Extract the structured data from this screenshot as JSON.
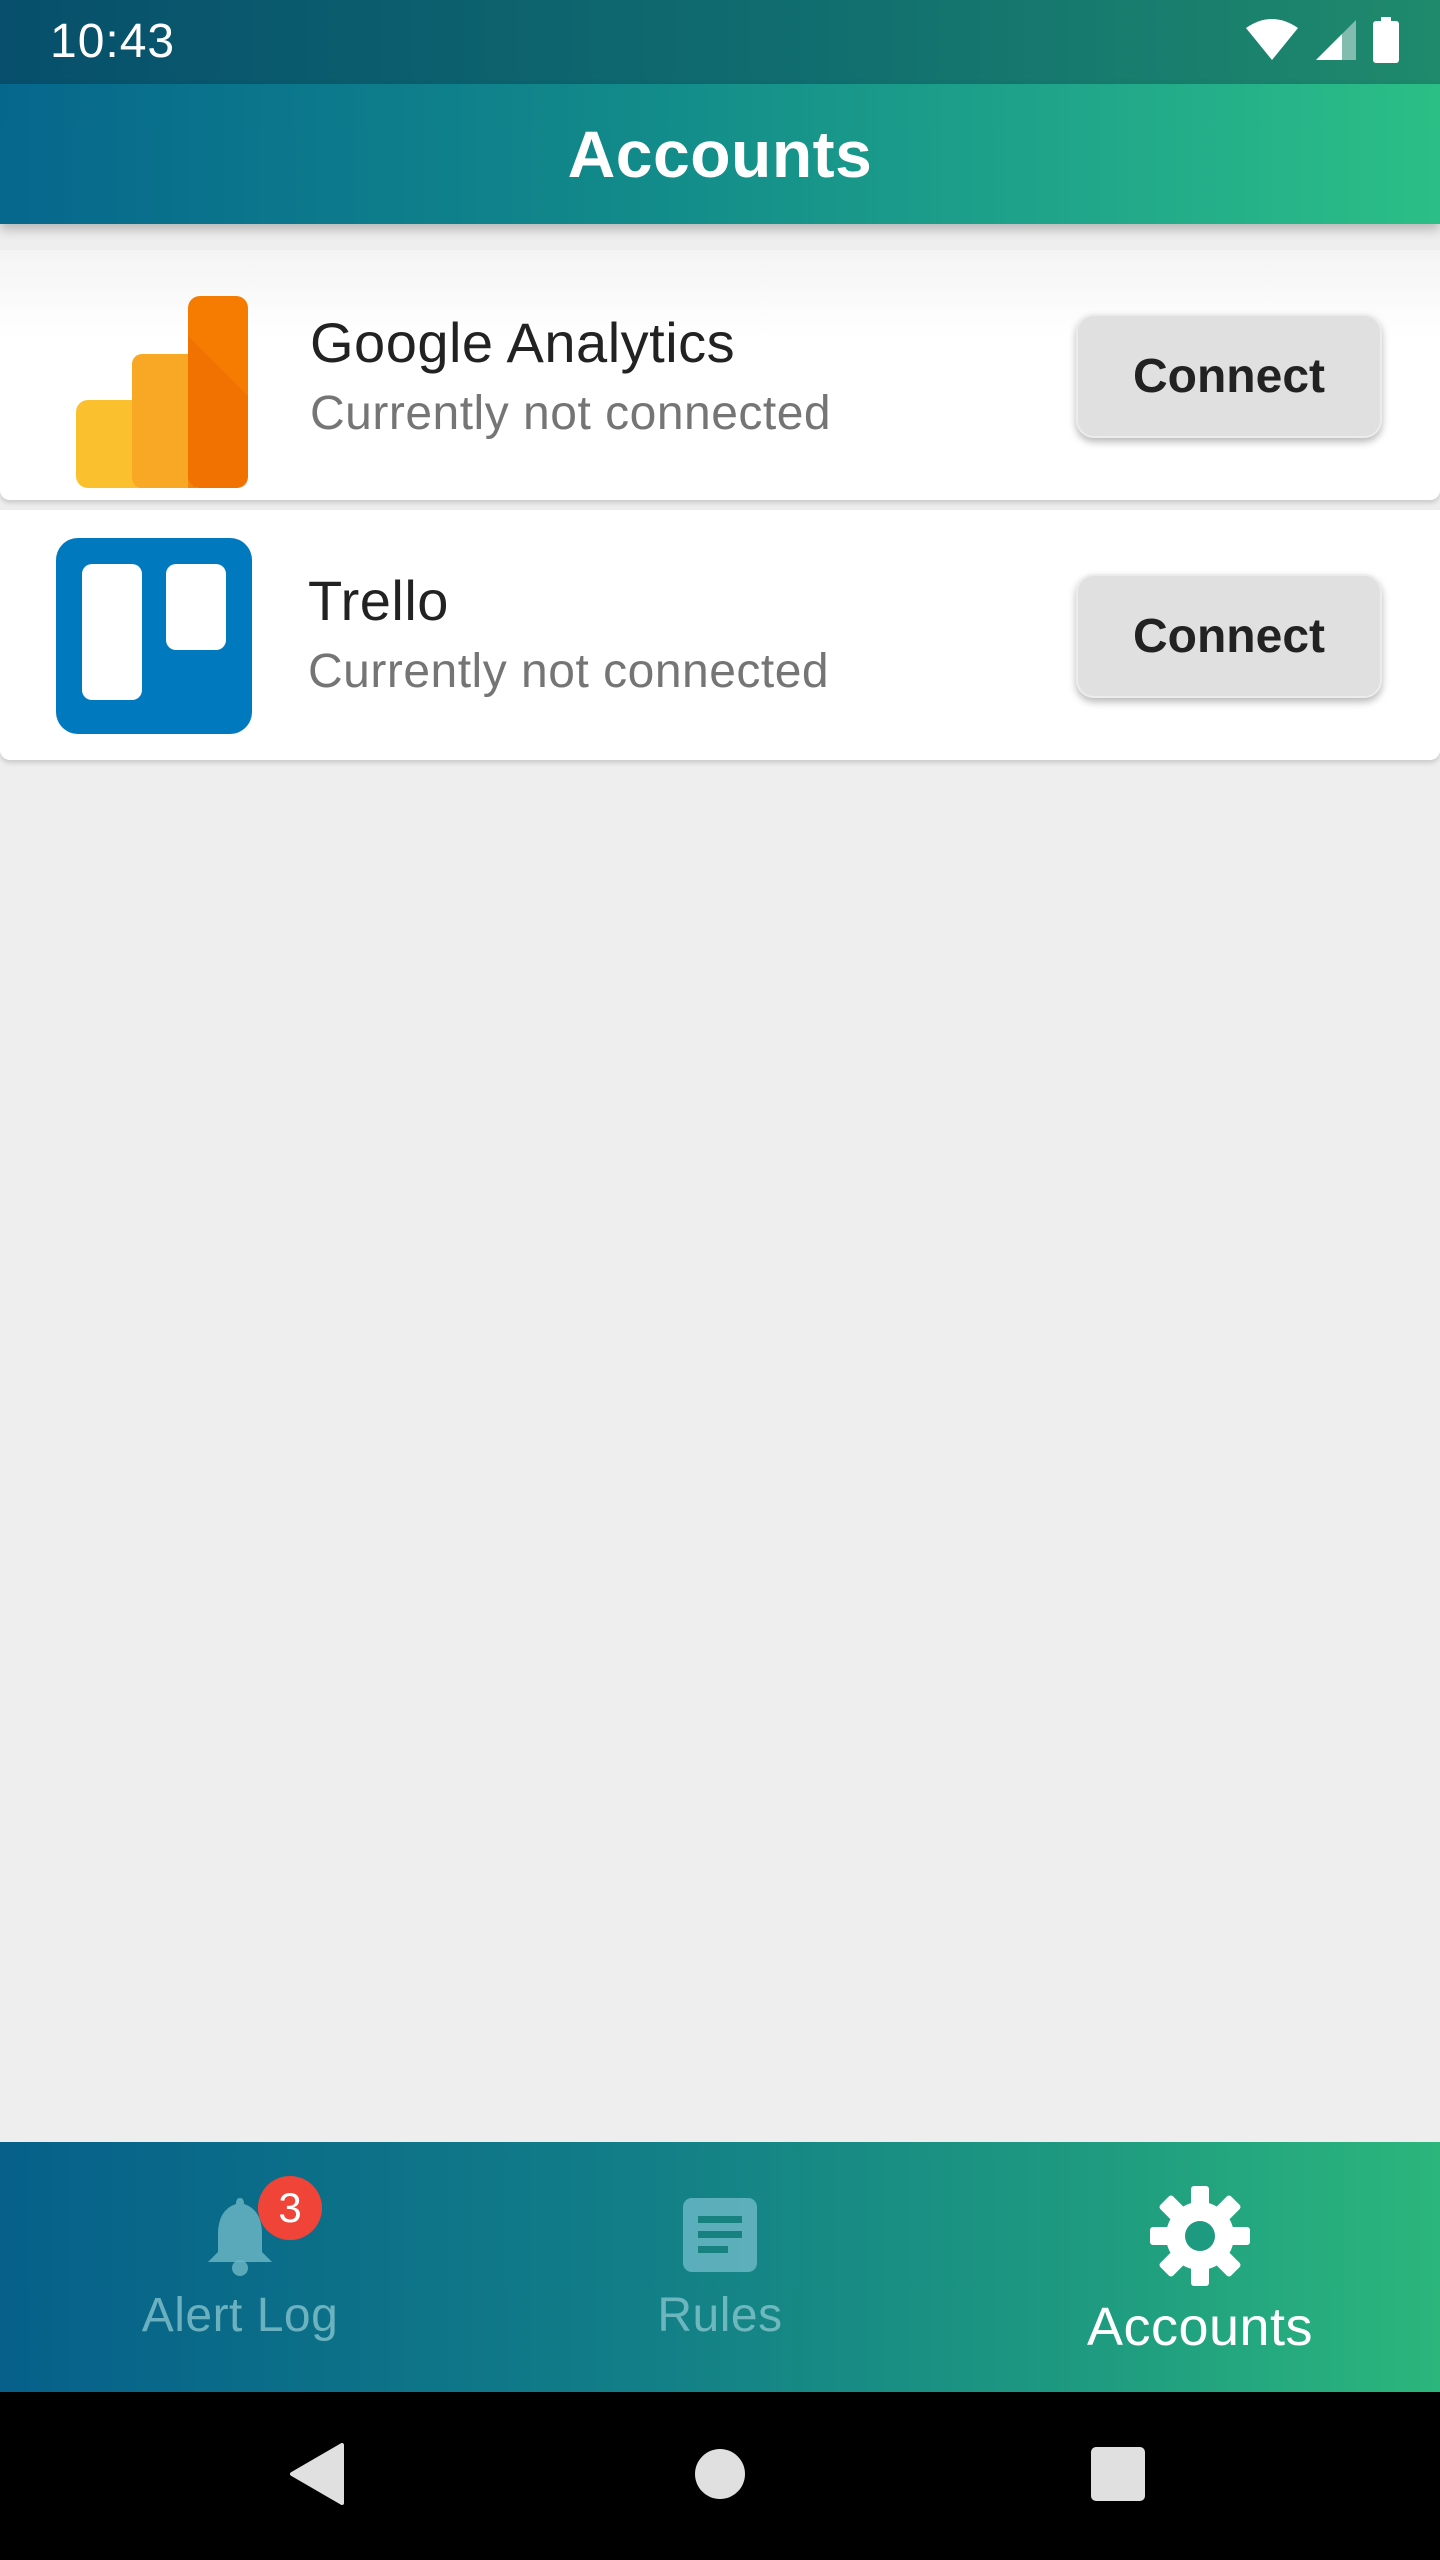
{
  "status_bar": {
    "time": "10:43",
    "icons": [
      "wifi-icon",
      "cell-signal-icon",
      "battery-icon"
    ]
  },
  "app_bar": {
    "title": "Accounts"
  },
  "accounts": [
    {
      "name": "Google Analytics",
      "status": "Currently not connected",
      "button_label": "Connect",
      "logo": "google-analytics-logo"
    },
    {
      "name": "Trello",
      "status": "Currently not connected",
      "button_label": "Connect",
      "logo": "trello-logo"
    }
  ],
  "bottom_nav": {
    "items": [
      {
        "label": "Alert Log",
        "icon": "bell-icon",
        "badge": "3",
        "active": false
      },
      {
        "label": "Rules",
        "icon": "document-list-icon",
        "active": false
      },
      {
        "label": "Accounts",
        "icon": "gear-icon",
        "active": true
      }
    ]
  },
  "system_nav": {
    "buttons": [
      "back-icon",
      "home-icon",
      "recents-icon"
    ]
  },
  "colors": {
    "accent_start": "#06678d",
    "accent_end": "#2bbf86",
    "badge": "#f04438",
    "trello_blue": "#0079bf",
    "ga_orange": "#f57c00",
    "ga_yellow": "#fbc02d"
  }
}
